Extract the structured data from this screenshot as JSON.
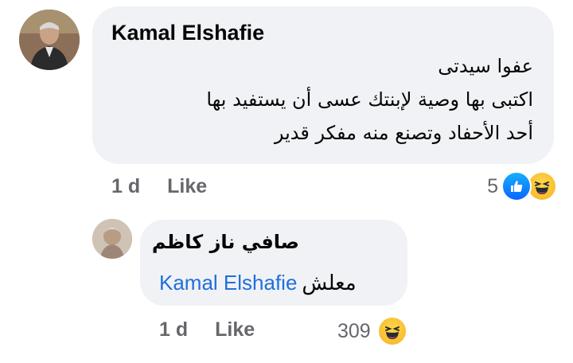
{
  "comment": {
    "author": "Kamal Elshafie",
    "lines": [
      "عفوا سيدتى",
      "اكتبى بها  وصية لإبنتك عسى أن يستفيد بها",
      "أحد الأحفاد وتصنع منه مفكر قدير"
    ],
    "time": "1 d",
    "like_label": "Like",
    "reaction_count": "5"
  },
  "reply": {
    "author": "صافي ناز كاظم",
    "mention": "Kamal Elshafie",
    "text": "معلش",
    "time": "1 d",
    "like_label": "Like",
    "reaction_count": "309"
  },
  "colors": {
    "bubble": "#f0f2f5",
    "meta_text": "#65676b",
    "mention": "#216fdb",
    "like_reaction": "#0866ff",
    "haha_reaction": "#f7b125"
  }
}
